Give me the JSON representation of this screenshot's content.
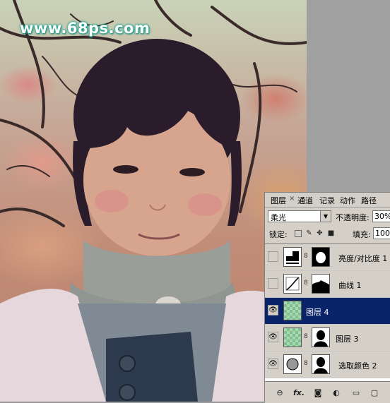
{
  "watermark": "www.68ps.com",
  "panel": {
    "tabs": [
      {
        "label": "图层",
        "active": true
      },
      {
        "label": "通道"
      },
      {
        "label": "记录"
      },
      {
        "label": "动作"
      },
      {
        "label": "路径"
      }
    ],
    "tab_close": "×",
    "blend_mode": "柔光",
    "opacity_label": "不透明度:",
    "opacity_value": "30%",
    "lock_label": "锁定:",
    "fill_label": "填充:",
    "fill_value": "100%",
    "layers": [
      {
        "name": "亮度/对比度 1",
        "visible": false,
        "thumb": "adjustment-brightness",
        "mask": true,
        "selected": false
      },
      {
        "name": "曲线 1",
        "visible": false,
        "thumb": "adjustment-curves",
        "mask": true,
        "selected": false
      },
      {
        "name": "图层 4",
        "visible": true,
        "thumb": "green-checker",
        "mask": false,
        "selected": true
      },
      {
        "name": "图层 3",
        "visible": true,
        "thumb": "green-checker",
        "mask": true,
        "selected": false
      },
      {
        "name": "选取颜色 2",
        "visible": true,
        "thumb": "adjustment-selective-color",
        "mask": true,
        "selected": false
      }
    ],
    "bottom_icons": [
      "link-layers-icon",
      "fx-icon",
      "mask-icon",
      "adjustment-icon",
      "group-icon",
      "new-layer-icon"
    ],
    "fx_label": "fx."
  },
  "colors": {
    "selected_row": "#0a246a",
    "panel_bg": "#d4d0c8",
    "watermark_glow": "#1aa38f"
  }
}
